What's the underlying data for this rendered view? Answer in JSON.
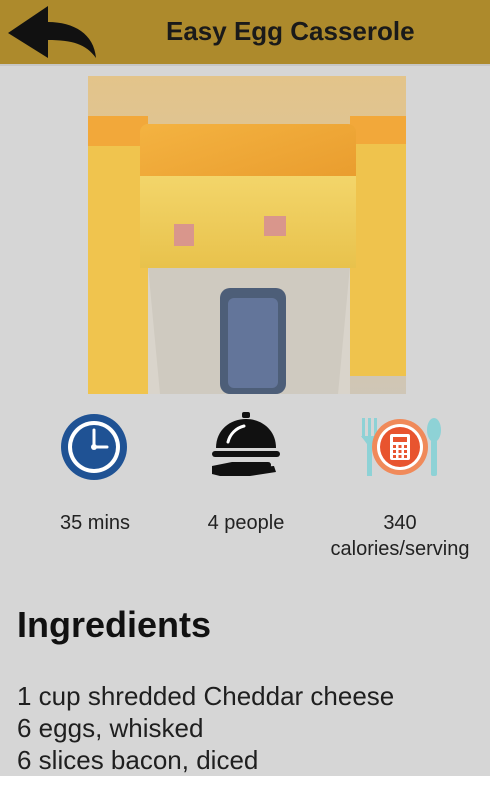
{
  "header": {
    "title": "Easy Egg Casserole",
    "back_icon": "back-arrow-icon",
    "background_color": "#ad8a2c"
  },
  "photo": {
    "subject": "egg casserole square on spatula"
  },
  "stats": [
    {
      "icon": "clock-icon",
      "label": "35 mins"
    },
    {
      "icon": "serving-cloche-icon",
      "label": "4 people"
    },
    {
      "icon": "calorie-calculator-icon",
      "label_line1": "340",
      "label_line2": "calories/serving"
    }
  ],
  "ingredients": {
    "heading": "Ingredients",
    "items": [
      "1 cup shredded Cheddar cheese",
      "6 eggs, whisked",
      "6 slices bacon, diced"
    ]
  }
}
